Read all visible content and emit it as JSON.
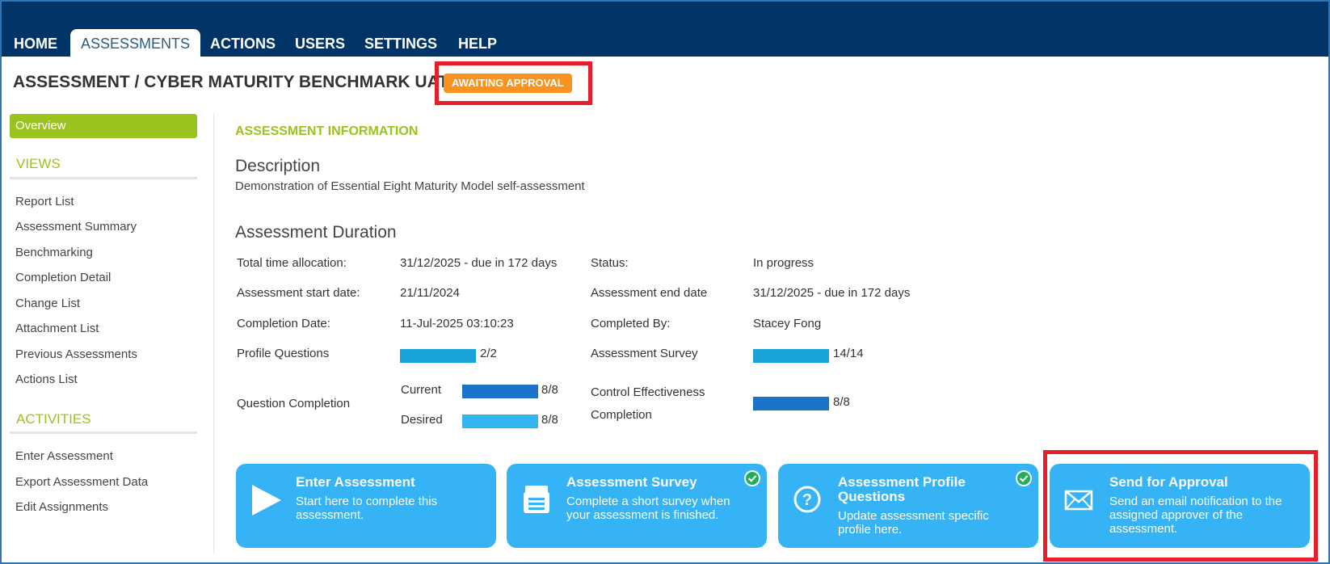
{
  "nav": {
    "tabs": [
      "HOME",
      "ASSESSMENTS",
      "ACTIONS",
      "USERS",
      "SETTINGS",
      "HELP"
    ],
    "active": "ASSESSMENTS"
  },
  "page": {
    "title": "ASSESSMENT / CYBER MATURITY BENCHMARK UAT",
    "status": "AWAITING APPROVAL"
  },
  "sidebar": {
    "overview": "Overview",
    "views_heading": "VIEWS",
    "views": [
      "Report List",
      "Assessment Summary",
      "Benchmarking",
      "Completion Detail",
      "Change List",
      "Attachment List",
      "Previous Assessments",
      "Actions List"
    ],
    "activities_heading": "ACTIVITIES",
    "activities": [
      "Enter Assessment",
      "Export Assessment Data",
      "Edit Assignments"
    ]
  },
  "main": {
    "section_heading": "ASSESSMENT INFORMATION",
    "description_heading": "Description",
    "description": "Demonstration of Essential Eight Maturity Model self-assessment",
    "duration_heading": "Assessment Duration",
    "fields": {
      "total_time_label": "Total time allocation:",
      "total_time_value": "31/12/2025 - due in 172 days",
      "status_label": "Status:",
      "status_value": "In progress",
      "start_label": "Assessment start date:",
      "start_value": "21/11/2024",
      "end_label": "Assessment end date",
      "end_value": "31/12/2025 - due in 172 days",
      "completion_date_label": "Completion Date:",
      "completion_date_value": "11-Jul-2025 03:10:23",
      "completed_by_label": "Completed By:",
      "completed_by_value": "Stacey Fong",
      "profile_q_label": "Profile Questions",
      "profile_q_value": "2/2",
      "profile_q_progress": 1.0,
      "survey_label": "Assessment Survey",
      "survey_value": "14/14",
      "survey_progress": 1.0,
      "question_completion_label": "Question Completion",
      "current_label": "Current",
      "current_value": "8/8",
      "current_progress": 1.0,
      "desired_label": "Desired",
      "desired_value": "8/8",
      "desired_progress": 1.0,
      "control_label_1": "Control Effectiveness",
      "control_label_2": "Completion",
      "control_value": "8/8",
      "control_progress": 1.0
    }
  },
  "cards": [
    {
      "title": "Enter Assessment",
      "desc": [
        "Start here to complete this",
        "assessment."
      ],
      "icon": "play-icon",
      "done": false
    },
    {
      "title": "Assessment Survey",
      "desc": [
        "Complete a short survey when",
        "your assessment is finished."
      ],
      "icon": "survey-icon",
      "done": true
    },
    {
      "title": [
        "Assessment Profile",
        "Questions"
      ],
      "desc": [
        "Update assessment specific",
        "profile here."
      ],
      "icon": "question-icon",
      "done": true
    },
    {
      "title": "Send for Approval",
      "desc": [
        "Send an email notification to the",
        "assigned approver of the",
        "assessment."
      ],
      "icon": "envelope-icon",
      "done": false
    }
  ],
  "colors": {
    "nav_bg": "#003366",
    "accent_green": "#9bc31e",
    "badge_orange": "#f7931e",
    "card_blue": "#35b3f5",
    "highlight_red": "#e61e2a"
  }
}
